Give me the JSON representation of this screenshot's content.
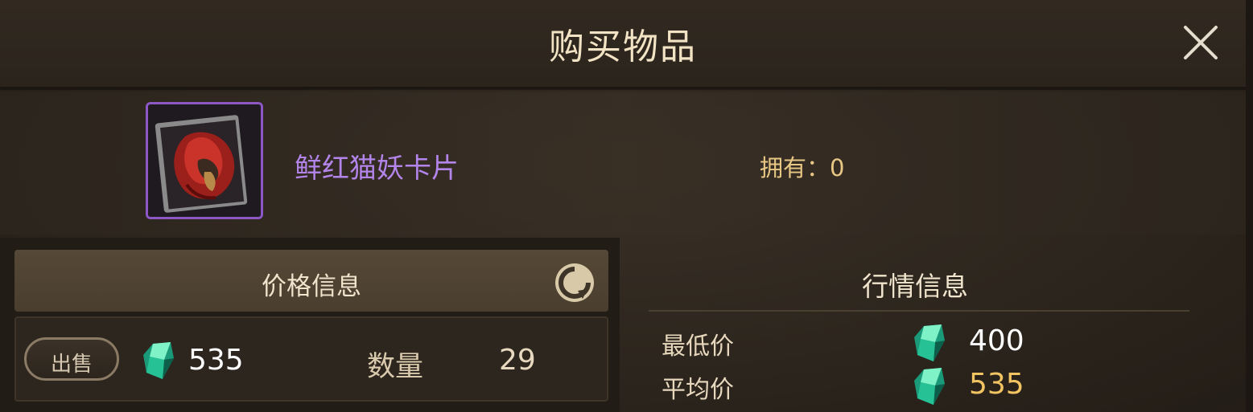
{
  "header": {
    "title": "购买物品"
  },
  "item": {
    "name": "鲜红猫妖卡片",
    "owned_label": "拥有：0"
  },
  "price_info": {
    "title": "价格信息",
    "sell_label": "出售",
    "price": "535",
    "quantity_label": "数量",
    "quantity": "29"
  },
  "market_info": {
    "title": "行情信息",
    "lowest_label": "最低价",
    "lowest_value": "400",
    "average_label": "平均价",
    "average_value": "535"
  },
  "icons": {
    "close": "close-icon",
    "refresh": "refresh-icon",
    "currency": "green-gem-icon",
    "item": "monster-card-icon"
  },
  "colors": {
    "item_name": "#b384ea",
    "owned": "#e8c784",
    "average_value": "#f3c462",
    "item_border": "#8d57c6"
  }
}
